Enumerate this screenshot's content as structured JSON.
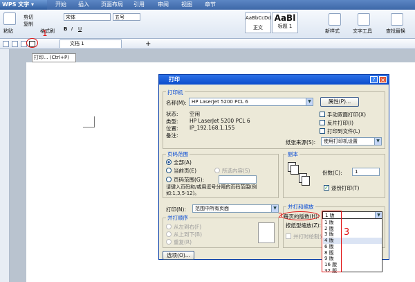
{
  "app": {
    "name": "WPS 文字",
    "menus": [
      "开始",
      "插入",
      "页面布局",
      "引用",
      "审阅",
      "视图",
      "章节"
    ]
  },
  "ribbon": {
    "paste": "粘贴",
    "cut": "剪切",
    "copy": "复制",
    "format_painter": "格式刷",
    "font": "宋体",
    "size": "五号",
    "style_normal": "AaBbCcDd",
    "style_normal_label": "正文",
    "style_h1": "AaBl",
    "style_h1_label": "标题 1",
    "new_style": "新样式",
    "text_tools": "文字工具",
    "find_replace": "查找替换"
  },
  "tab": {
    "doc_name": "文档 1"
  },
  "tooltip": "打印... (Ctrl+P)",
  "annotations": {
    "n1": "1",
    "n2": "2",
    "n3": "3"
  },
  "dialog": {
    "title": "打印",
    "printer": {
      "group": "打印机",
      "name_label": "名称(M):",
      "name_value": "HP LaserJet 5200 PCL 6",
      "properties_btn": "属性(P)...",
      "status_label": "状态:",
      "status_value": "空闲",
      "type_label": "类型:",
      "type_value": "HP LaserJet 5200 PCL 6",
      "location_label": "位置:",
      "location_value": "IP_192.168.1.155",
      "comment_label": "备注:",
      "manual_duplex": "手动双面打印(X)",
      "reverse": "反片打印(I)",
      "print_to_file": "打印到文件(L)",
      "paper_source_label": "纸张来源(S):",
      "paper_source_value": "使用打印机设置"
    },
    "range": {
      "group": "页码范围",
      "all": "全部(A)",
      "current": "当前页(E)",
      "selection": "所选内容(S)",
      "pages": "页码范围(G):",
      "hint": "请键入页码和/或用逗号分隔的页码范围(例如:1,3,5-12)。"
    },
    "copies": {
      "group": "副本",
      "count_label": "份数(C):",
      "count_value": "1",
      "collate": "逐份打印(T)"
    },
    "print_what": {
      "label": "打印(N):",
      "value": "范围中所有页面"
    },
    "order": {
      "group": "并打顺序",
      "ltr": "从左到右(F)",
      "ttb": "从上到下(B)",
      "repeat": "重复(R)"
    },
    "zoom": {
      "group": "并打和缩放",
      "per_sheet_label": "每页的版数(H):",
      "per_sheet_value": "1 版",
      "scale_label": "按纸型缩放(Z):",
      "draw_border": "并打时绘制分"
    },
    "options_btn": "选项(O)...",
    "options_list": [
      "1 版",
      "2 版",
      "3 版",
      "4 版",
      "6 版",
      "8 版",
      "9 版",
      "16 版",
      "32 版"
    ]
  }
}
